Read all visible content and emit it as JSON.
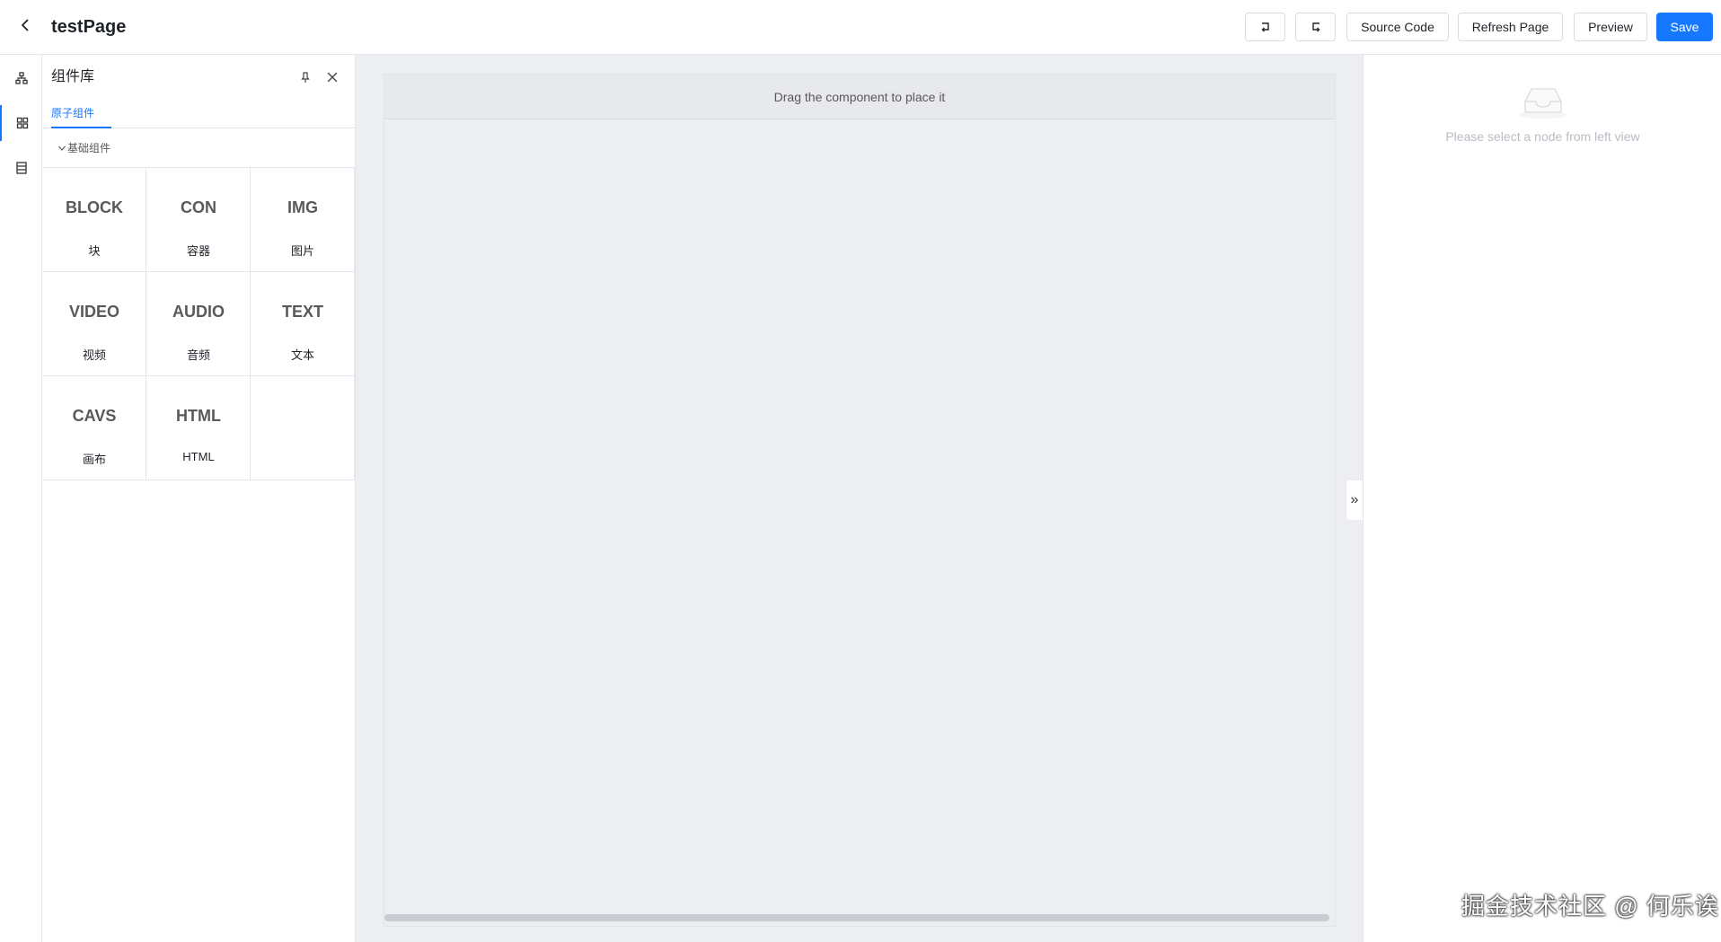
{
  "header": {
    "title": "testPage",
    "buttons": {
      "source_code": "Source Code",
      "refresh_page": "Refresh Page",
      "preview": "Preview",
      "save": "Save"
    },
    "icons": {
      "back": "chevron-left-icon",
      "undo": "undo-icon",
      "redo": "redo-icon"
    }
  },
  "activity_bar": {
    "items": [
      {
        "icon": "tree-structure-icon"
      },
      {
        "icon": "components-icon",
        "active": true
      },
      {
        "icon": "data-source-icon"
      }
    ]
  },
  "component_panel": {
    "title": "组件库",
    "tabs": [
      {
        "label": "原子组件",
        "active": true
      }
    ],
    "group": {
      "label": "基础组件",
      "expanded": true
    },
    "components": [
      {
        "code": "BLOCK",
        "name": "块"
      },
      {
        "code": "CON",
        "name": "容器"
      },
      {
        "code": "IMG",
        "name": "图片"
      },
      {
        "code": "VIDEO",
        "name": "视频"
      },
      {
        "code": "AUDIO",
        "name": "音频"
      },
      {
        "code": "TEXT",
        "name": "文本"
      },
      {
        "code": "CAVS",
        "name": "画布"
      },
      {
        "code": "HTML",
        "name": "HTML"
      }
    ]
  },
  "canvas": {
    "drop_hint": "Drag the component to place it",
    "collapse_toggle": "»"
  },
  "settings_panel": {
    "empty_text": "Please select a node from left view"
  },
  "watermark": "掘金技术社区 @ 何乐诶",
  "colors": {
    "accent": "#1677ff",
    "canvas_bg": "#eceef2",
    "border": "#e5e6eb"
  }
}
